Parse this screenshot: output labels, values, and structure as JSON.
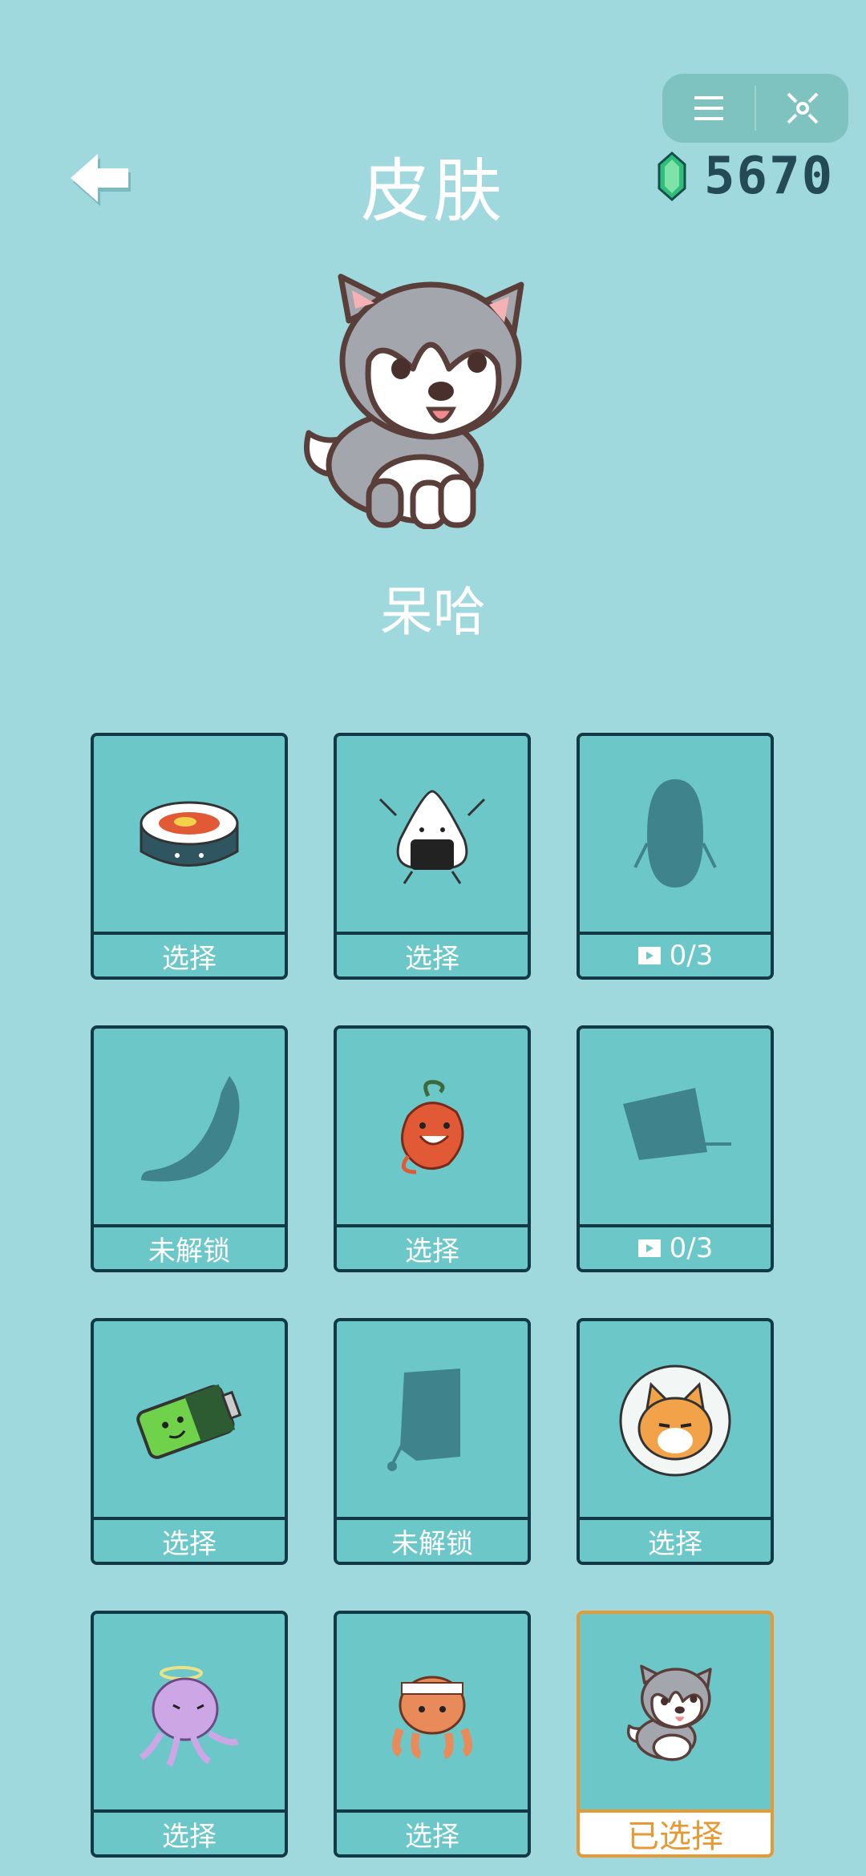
{
  "header": {
    "title": "皮肤",
    "currency_amount": "5670",
    "icons": {
      "back": "back-arrow-icon",
      "menu": "menu-icon",
      "close": "close-icon",
      "currency": "gem-icon"
    }
  },
  "hero": {
    "name": "呆哈"
  },
  "colors": {
    "background": "#9fd9de",
    "card": "#6cc7c9",
    "border": "#133846",
    "selected": "#e69a35",
    "silhouette": "#3f848c"
  },
  "skins": [
    {
      "label": "选择",
      "state": "available",
      "icon": "sushi-roll"
    },
    {
      "label": "选择",
      "state": "available",
      "icon": "onigiri"
    },
    {
      "label": "0/3",
      "state": "video-unlock",
      "icon": "locked-silhouette-oval"
    },
    {
      "label": "未解锁",
      "state": "locked",
      "icon": "locked-silhouette-banana"
    },
    {
      "label": "选择",
      "state": "available",
      "icon": "chili-devil"
    },
    {
      "label": "0/3",
      "state": "video-unlock",
      "icon": "locked-silhouette-box"
    },
    {
      "label": "选择",
      "state": "available",
      "icon": "battery"
    },
    {
      "label": "未解锁",
      "state": "locked",
      "icon": "locked-silhouette-bag"
    },
    {
      "label": "选择",
      "state": "available",
      "icon": "cat-badge"
    },
    {
      "label": "选择",
      "state": "available",
      "icon": "jellyfish"
    },
    {
      "label": "选择",
      "state": "available",
      "icon": "octopus"
    },
    {
      "label": "已选择",
      "state": "selected",
      "icon": "husky"
    }
  ]
}
